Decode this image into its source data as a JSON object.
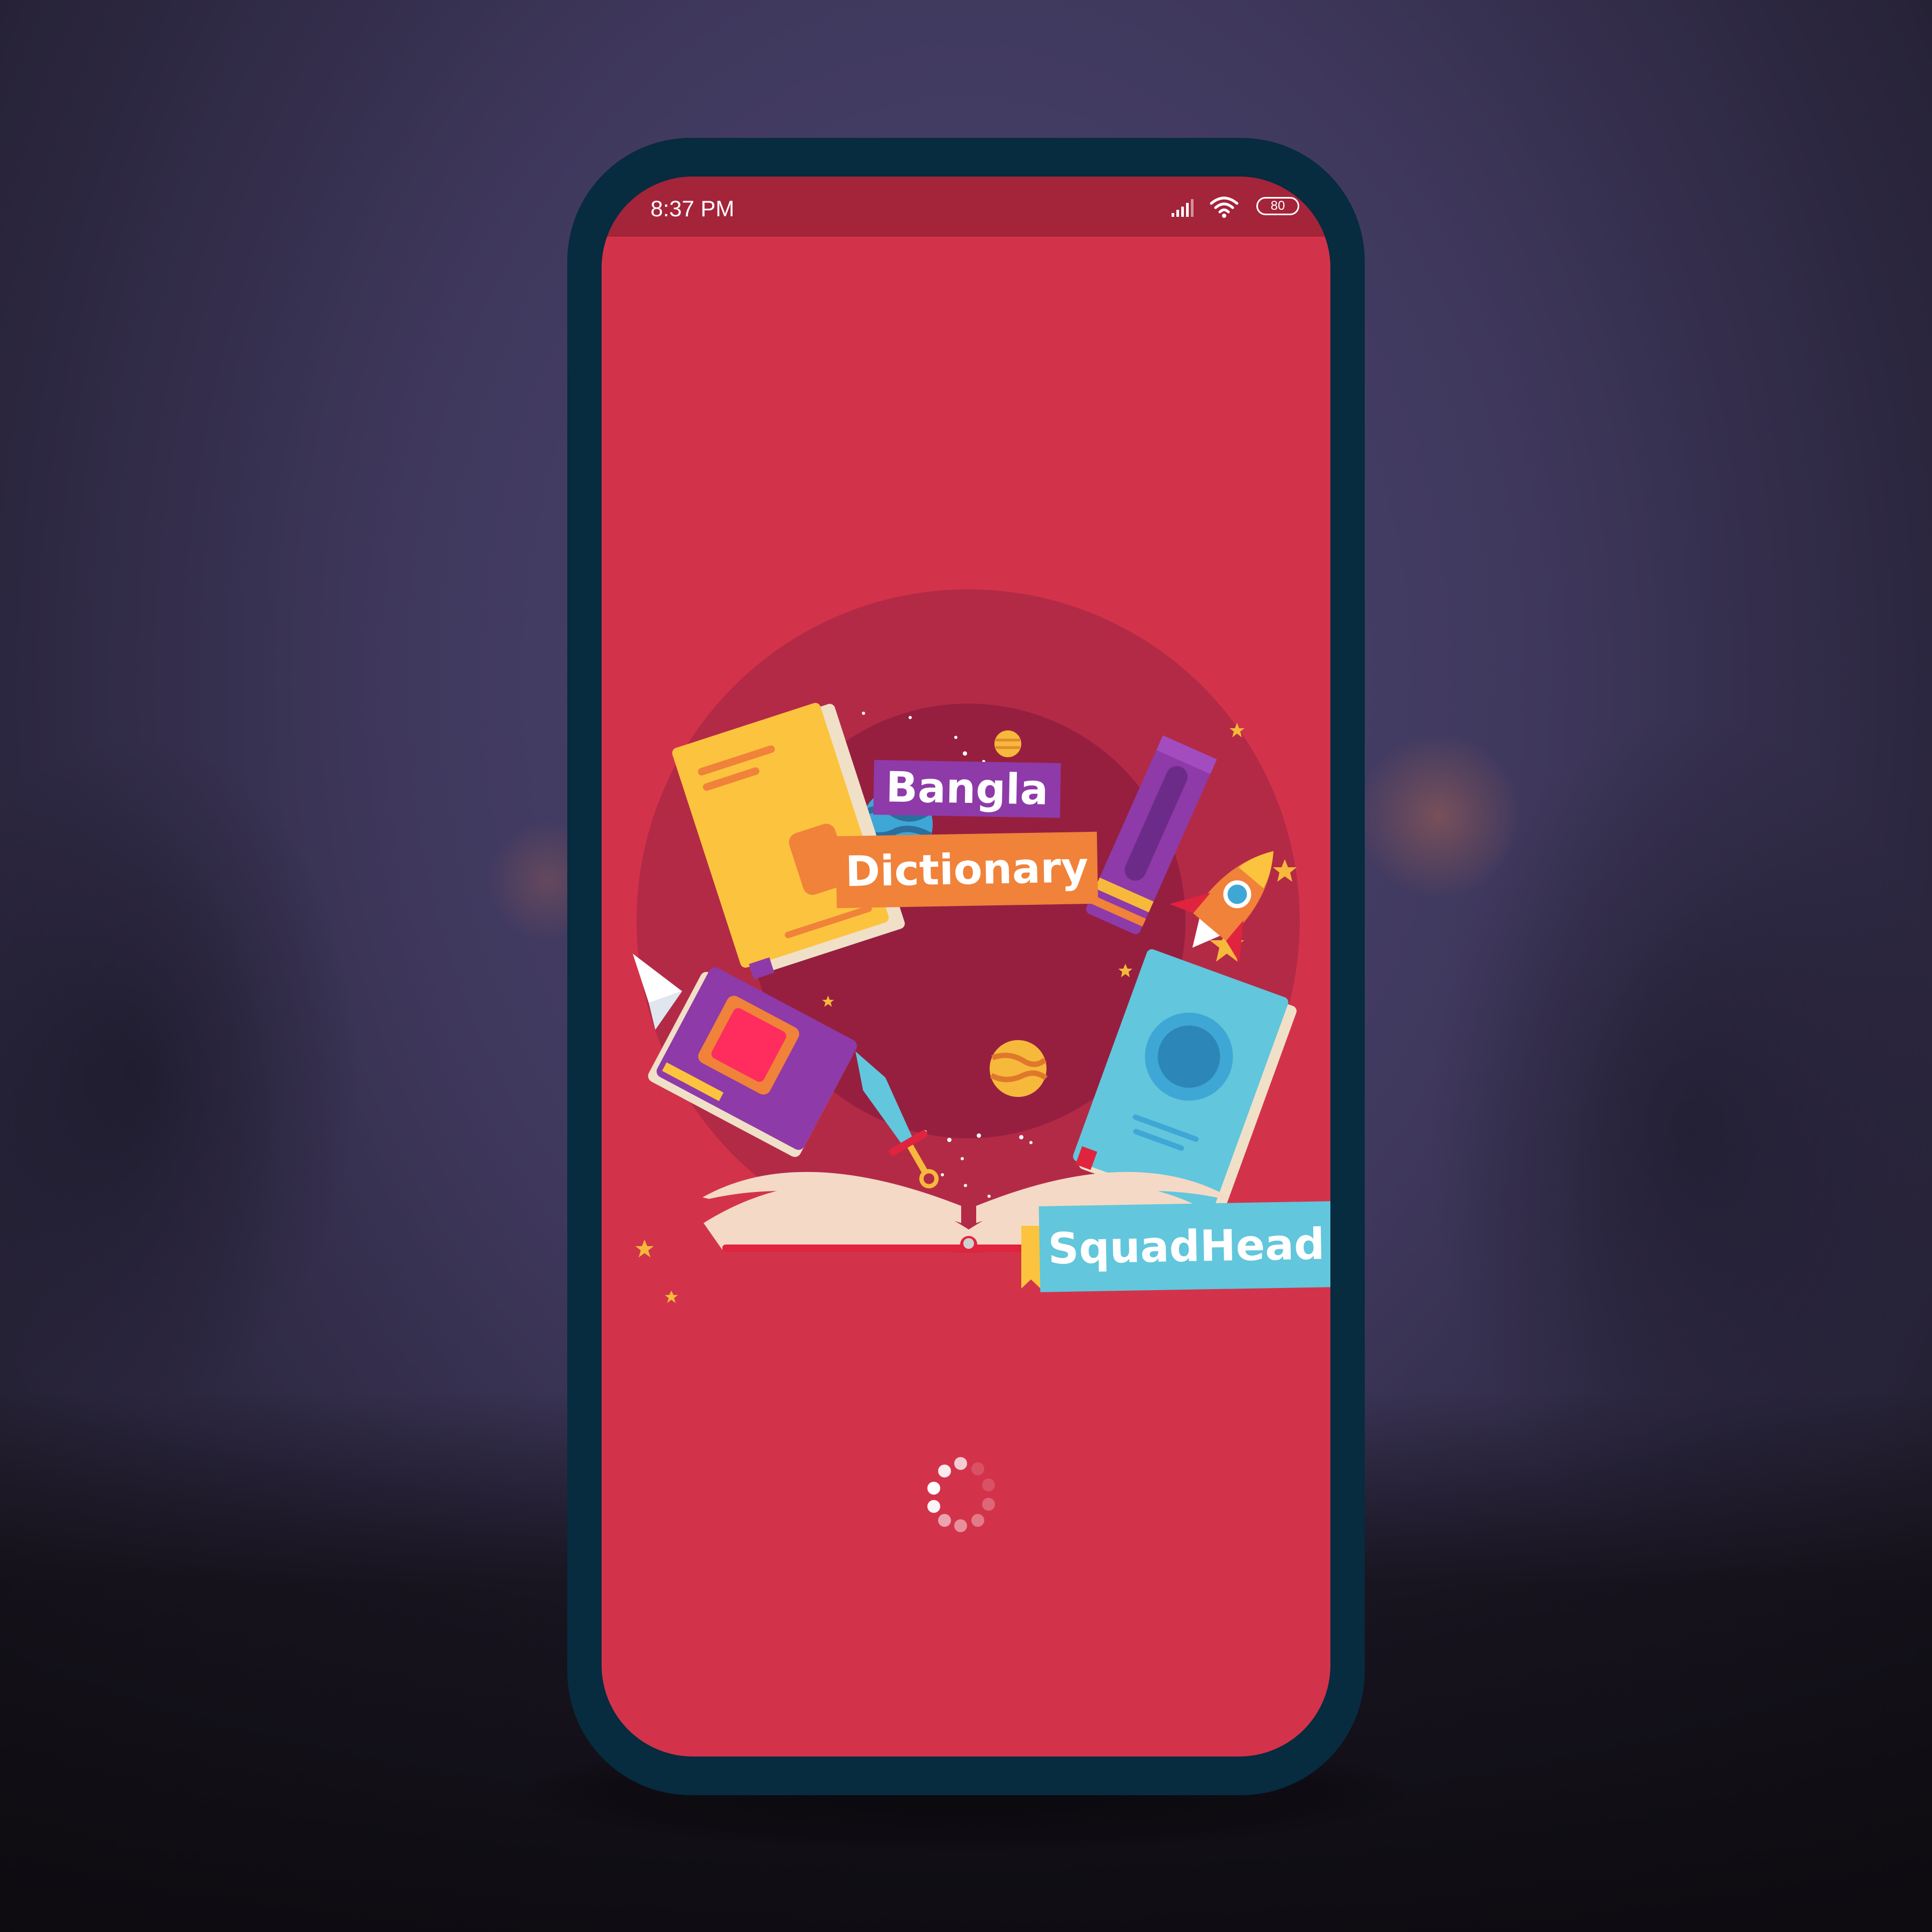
{
  "status_bar": {
    "time": "8:37 PM",
    "battery_level": "80",
    "icons": [
      "signal-icon",
      "wifi-icon",
      "battery-icon"
    ]
  },
  "splash": {
    "title_line1": "Bangla",
    "title_line2": "Dictionary",
    "brand": "SquadHead",
    "loading": true
  },
  "colors": {
    "screen_background": "#d3334a",
    "status_bar": "#a4243a",
    "phone_frame": "#072b3f",
    "title_line1_tag": "#8e3aa8",
    "title_line2_tag": "#f0823a",
    "brand_tag": "#62c6dc"
  }
}
